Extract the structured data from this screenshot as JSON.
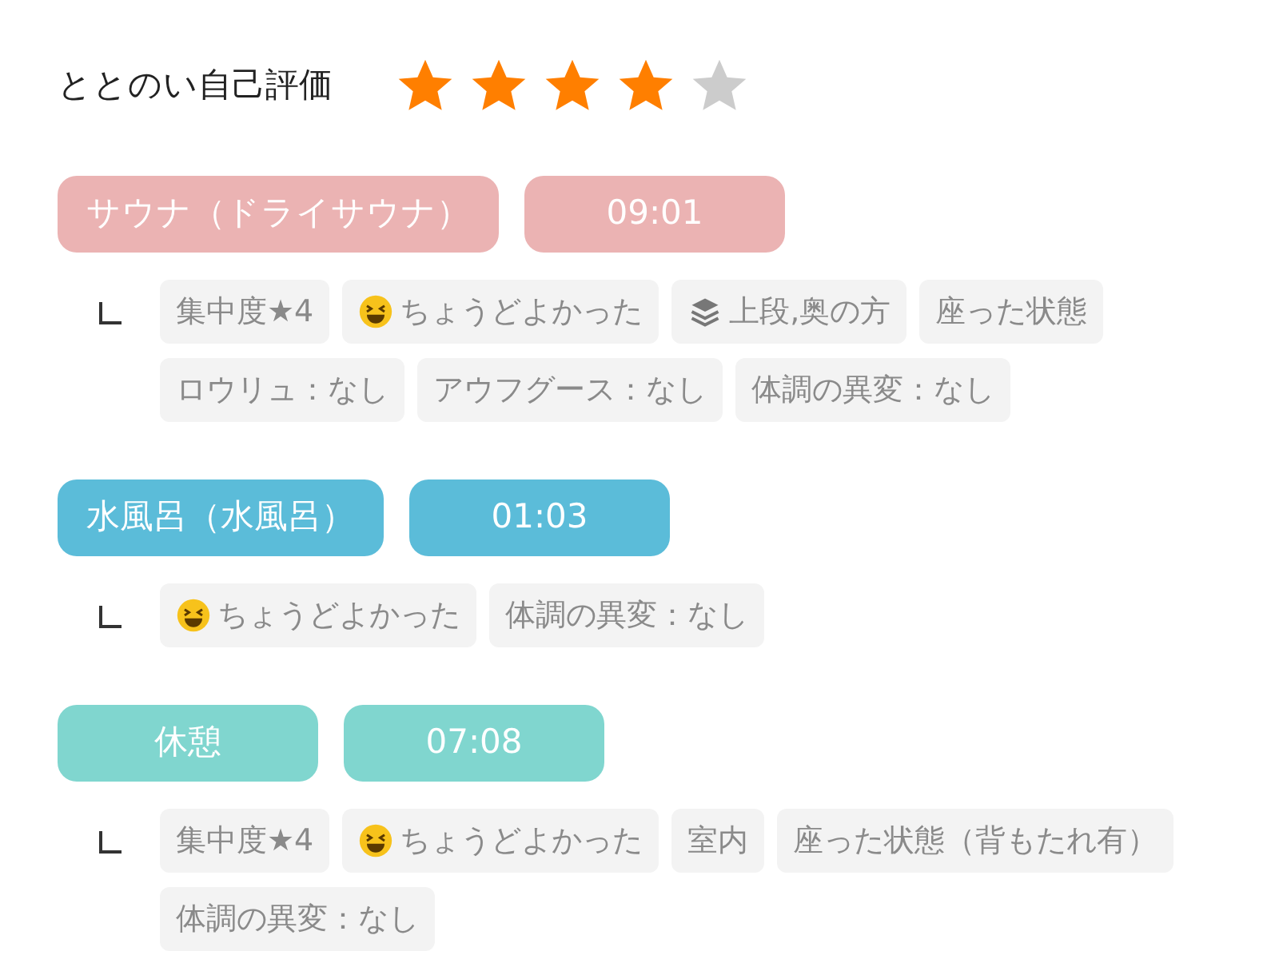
{
  "rating": {
    "label": "ととのい自己評価",
    "stars": 4
  },
  "sections": [
    {
      "name": "サウナ（ドライサウナ）",
      "time": "09:01",
      "color": "#ebb3b3",
      "tags": [
        {
          "kind": "plain",
          "text": "集中度★4"
        },
        {
          "kind": "laugh",
          "text": "ちょうどよかった"
        },
        {
          "kind": "layers",
          "text": "上段,奥の方"
        },
        {
          "kind": "plain",
          "text": "座った状態"
        },
        {
          "kind": "plain",
          "text": "ロウリュ：なし"
        },
        {
          "kind": "plain",
          "text": "アウフグース：なし"
        },
        {
          "kind": "plain",
          "text": "体調の異変：なし"
        }
      ]
    },
    {
      "name": "水風呂（水風呂）",
      "time": "01:03",
      "color": "#5bbcd9",
      "tags": [
        {
          "kind": "laugh",
          "text": "ちょうどよかった"
        },
        {
          "kind": "plain",
          "text": "体調の異変：なし"
        }
      ]
    },
    {
      "name": "休憩",
      "time": "07:08",
      "color": "#80d6cf",
      "tags": [
        {
          "kind": "plain",
          "text": "集中度★4"
        },
        {
          "kind": "laugh",
          "text": "ちょうどよかった"
        },
        {
          "kind": "plain",
          "text": "室内"
        },
        {
          "kind": "plain",
          "text": "座った状態（背もたれ有）"
        },
        {
          "kind": "plain",
          "text": "体調の異変：なし"
        }
      ]
    }
  ]
}
